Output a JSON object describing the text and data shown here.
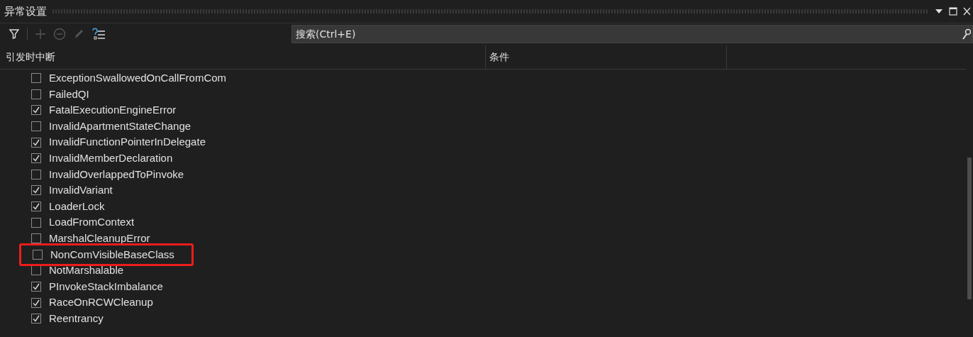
{
  "panel": {
    "title": "异常设置"
  },
  "search": {
    "placeholder": "搜索(Ctrl+E)"
  },
  "columns": [
    "引发时中断",
    "条件"
  ],
  "items": [
    {
      "label": "ExceptionSwallowedOnCallFromCom",
      "checked": false,
      "highlighted": false
    },
    {
      "label": "FailedQI",
      "checked": false,
      "highlighted": false
    },
    {
      "label": "FatalExecutionEngineError",
      "checked": true,
      "highlighted": false
    },
    {
      "label": "InvalidApartmentStateChange",
      "checked": false,
      "highlighted": false
    },
    {
      "label": "InvalidFunctionPointerInDelegate",
      "checked": true,
      "highlighted": false
    },
    {
      "label": "InvalidMemberDeclaration",
      "checked": true,
      "highlighted": false
    },
    {
      "label": "InvalidOverlappedToPinvoke",
      "checked": false,
      "highlighted": false
    },
    {
      "label": "InvalidVariant",
      "checked": true,
      "highlighted": false
    },
    {
      "label": "LoaderLock",
      "checked": true,
      "highlighted": false
    },
    {
      "label": "LoadFromContext",
      "checked": false,
      "highlighted": false
    },
    {
      "label": "MarshalCleanupError",
      "checked": false,
      "highlighted": false
    },
    {
      "label": "NonComVisibleBaseClass",
      "checked": false,
      "highlighted": true
    },
    {
      "label": "NotMarshalable",
      "checked": false,
      "highlighted": false
    },
    {
      "label": "PInvokeStackImbalance",
      "checked": true,
      "highlighted": false
    },
    {
      "label": "RaceOnRCWCleanup",
      "checked": true,
      "highlighted": false
    },
    {
      "label": "Reentrancy",
      "checked": true,
      "highlighted": false
    }
  ]
}
